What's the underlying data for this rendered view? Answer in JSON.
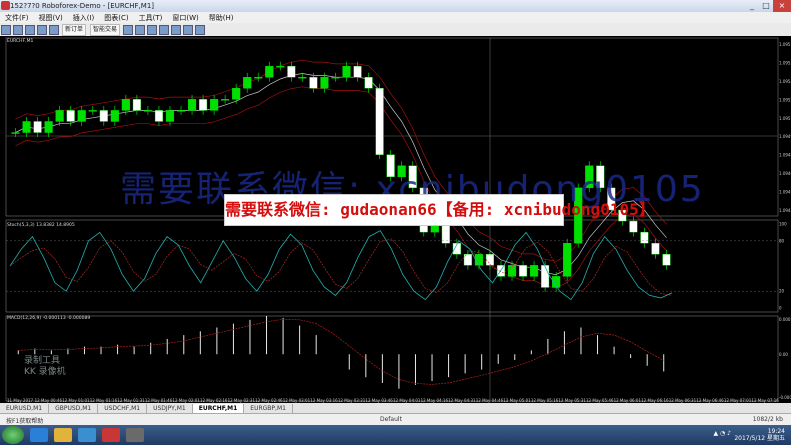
{
  "window": {
    "title": "152?7?0 Roboforex-Demo - [EURCHF,M1]"
  },
  "menu": [
    "文件(F)",
    "视图(V)",
    "插入(I)",
    "图表(C)",
    "工具(T)",
    "窗口(W)",
    "帮助(H)"
  ],
  "toolbar": {
    "btn1": "新订单",
    "btn2": "智能交易"
  },
  "window_buttons": {
    "min": "_",
    "max": "□",
    "close": "×"
  },
  "panels": {
    "main_title": "EURCHF,M1",
    "stoch_title": "Stoch(5,3,3) 13.8382 14.8905",
    "macd_title": "MACD(12,26,9) -0.000113 -0.000089"
  },
  "price_axis": [
    "1.09570",
    "1.09555",
    "1.09540",
    "1.09525",
    "1.09510",
    "1.09495",
    "1.09480",
    "1.09465",
    "1.09450",
    "1.09435"
  ],
  "stoch_axis": [
    "100",
    "80",
    "20",
    "0"
  ],
  "macd_axis": [
    "0.000224",
    "0.00",
    "-0.00035"
  ],
  "time_axis": [
    "11 May 2017",
    "12 May 00:46",
    "12 May 01:01",
    "12 May 01:16",
    "12 May 01:31",
    "12 May 01:46",
    "12 May 02:01",
    "12 May 02:16",
    "12 May 02:31",
    "12 May 02:46",
    "12 May 03:01",
    "12 May 03:16",
    "12 May 03:31",
    "12 May 03:46",
    "12 May 04:01",
    "12 May 04:16",
    "12 May 04:31",
    "12 May 04:46",
    "12 May 05:01",
    "12 May 05:16",
    "12 May 05:31",
    "12 May 05:46",
    "12 May 06:01",
    "12 May 06:16",
    "12 May 06:31",
    "12 May 06:46",
    "12 May 07:01",
    "12 May 07:16"
  ],
  "tabs": [
    "EURUSD,M1",
    "GBPUSD,M1",
    "USDCHF,M1",
    "USDJPY,M1",
    "EURCHF,M1",
    "EURGBP,M1"
  ],
  "active_tab": 4,
  "status": {
    "left": "按F1获取帮助",
    "mid": "Default",
    "right": "1082/2 kb"
  },
  "taskbar": {
    "clock_time": "19:24",
    "clock_date": "2017/5/12 星期五"
  },
  "watermark": {
    "big": "需要联系微信: xcnibudong0105",
    "banner": "需要联系微信: gudaonan66【备用: xcnibudong0105】",
    "rec1": "录制工具",
    "rec2": "KK 录像机"
  },
  "colors": {
    "bull": "#00e000",
    "bear": "#ffffff",
    "band": "#a01010",
    "ma": "#c8c8c8",
    "stoch_main": "#20b0b0",
    "stoch_signal": "#c03030",
    "macd_signal": "#b02020"
  },
  "chart_data": {
    "type": "candlestick",
    "symbol": "EURCHF",
    "timeframe": "M1",
    "ylim": [
      1.0943,
      1.0958
    ],
    "closes": [
      1.095,
      1.0951,
      1.095,
      1.0951,
      1.0952,
      1.0951,
      1.0952,
      1.0952,
      1.0951,
      1.0952,
      1.0953,
      1.0952,
      1.0952,
      1.0951,
      1.0952,
      1.0952,
      1.0953,
      1.0952,
      1.0953,
      1.0953,
      1.0954,
      1.0955,
      1.0955,
      1.0956,
      1.0956,
      1.0955,
      1.0955,
      1.0954,
      1.0955,
      1.0955,
      1.0956,
      1.0955,
      1.0954,
      1.0948,
      1.0946,
      1.0947,
      1.0945,
      1.0941,
      1.0942,
      1.094,
      1.0939,
      1.0938,
      1.0939,
      1.0938,
      1.0937,
      1.0938,
      1.0937,
      1.0938,
      1.0936,
      1.0937,
      1.094,
      1.0945,
      1.0947,
      1.0945,
      1.0943,
      1.0942,
      1.0941,
      1.094,
      1.0939,
      1.0938
    ],
    "stoch": [
      50,
      70,
      85,
      60,
      30,
      20,
      45,
      80,
      90,
      70,
      40,
      20,
      35,
      65,
      85,
      75,
      50,
      30,
      55,
      80,
      60,
      35,
      20,
      40,
      70,
      88,
      75,
      45,
      25,
      15,
      30,
      60,
      85,
      92,
      70,
      40,
      20,
      10,
      25,
      55,
      80,
      70,
      45,
      30,
      50,
      75,
      90,
      70,
      40,
      20,
      10,
      30,
      65,
      85,
      70,
      45,
      25,
      15,
      12,
      18
    ],
    "macd": [
      2e-05,
      3e-05,
      2e-05,
      3e-05,
      4e-05,
      4e-05,
      5e-05,
      4e-05,
      6e-05,
      8e-05,
      0.0001,
      0.00012,
      0.00014,
      0.00016,
      0.00018,
      0.0002,
      0.00019,
      0.00015,
      0.0001,
      0.0,
      -8e-05,
      -0.00012,
      -0.00015,
      -0.00018,
      -0.00016,
      -0.00014,
      -0.00012,
      -0.0001,
      -8e-05,
      -5e-05,
      -3e-05,
      2e-05,
      8e-05,
      0.00012,
      0.00014,
      0.0001,
      4e-05,
      -2e-05,
      -6e-05,
      -9e-05
    ]
  }
}
